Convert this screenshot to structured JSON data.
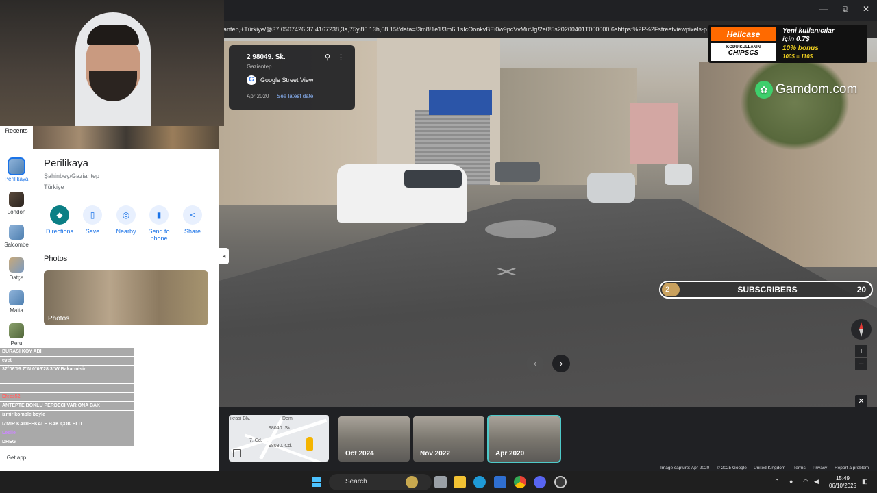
{
  "browser": {
    "url": "antep,+Türkiye/@37.0507426,37.4167238,3a,75y,86.13h,68.15t/data=!3m8!1e1!3m6!1sIcOonkvBEi0w9pcVvMufJg!2e0!5s20200401T000000!6shttps:%2F%2Fstreetviewpixels-p",
    "minimize": "—",
    "maximize": "⧉",
    "close": "✕"
  },
  "location_card": {
    "title": "2 98049. Sk.",
    "subtitle": "Gaziantep",
    "source": "Google Street View",
    "date": "Apr 2020",
    "latest_link": "See latest date"
  },
  "rail": {
    "recents_label": "Recents",
    "items": [
      {
        "label": "Perilikaya"
      },
      {
        "label": "London"
      },
      {
        "label": "Salcombe"
      },
      {
        "label": "Datça"
      },
      {
        "label": "Malta"
      },
      {
        "label": "Peru"
      }
    ],
    "get_app": "Get app"
  },
  "place": {
    "title": "Perilikaya",
    "subtitle": "Şahinbey/Gaziantep",
    "country": "Türkiye",
    "actions": [
      {
        "label": "Directions",
        "icon": "◆"
      },
      {
        "label": "Save",
        "icon": "▯"
      },
      {
        "label": "Nearby",
        "icon": "◎"
      },
      {
        "label": "Send to phone",
        "icon": "▮"
      },
      {
        "label": "Share",
        "icon": "<"
      }
    ],
    "photos_heading": "Photos",
    "photos_label": "Photos"
  },
  "chat": [
    {
      "user": "",
      "msg": "BURASI KOY ABI"
    },
    {
      "user": "",
      "msg": "evet"
    },
    {
      "user": "",
      "msg": "37°06'19.7\"N 0°05'28.3\"W Bakarmisin"
    },
    {
      "user": "",
      "msg": ""
    },
    {
      "user": "",
      "msg": ""
    },
    {
      "user": "Efees52",
      "msg": ""
    },
    {
      "user": "",
      "msg": "ANTEPTE BOKLU PERDECI VAR ONA BAK"
    },
    {
      "user": "",
      "msg": "izmir komple boyle"
    },
    {
      "user": "",
      "msg": "IZMIR KADIFEKALE BAK ÇOK ELIT"
    },
    {
      "user": "Leslie",
      "msg": ""
    },
    {
      "user": "",
      "msg": "DHEG"
    }
  ],
  "ads": {
    "hellcase_logo": "Hellcase",
    "hellcase_code_label": "KODU KULLANIN",
    "hellcase_code": "CHIPSCS",
    "hellcase_line1": "Yeni kullanıcılar",
    "hellcase_line2": "için 0.7$",
    "hellcase_line3": "10% bonus",
    "hellcase_line4": "100$ = 110$",
    "gamdom": "Gamdom.com"
  },
  "subscribers": {
    "current": "2",
    "label": "SUBSCRIBERS",
    "goal": "20",
    "progress_fraction": 0.1
  },
  "controls": {
    "zoom_in": "+",
    "zoom_out": "−",
    "close": "✕",
    "prev": "‹",
    "next": "›",
    "collapse": "◂"
  },
  "minimap": {
    "labels": [
      "ikrasi Blv.",
      "98040. Sk.",
      "98030. Cd.",
      "7. Cd.",
      "Dem"
    ]
  },
  "filmstrip": [
    {
      "label": "Oct 2024",
      "active": false
    },
    {
      "label": "Nov 2022",
      "active": false
    },
    {
      "label": "Apr 2020",
      "active": true
    }
  ],
  "footer": {
    "capture": "Image capture: Apr 2020",
    "copyright": "© 2025 Google",
    "region": "United Kingdom",
    "terms": "Terms",
    "privacy": "Privacy",
    "report": "Report a problem"
  },
  "taskbar": {
    "search": "Search",
    "time": "15:49",
    "date": "06/10/2025"
  }
}
